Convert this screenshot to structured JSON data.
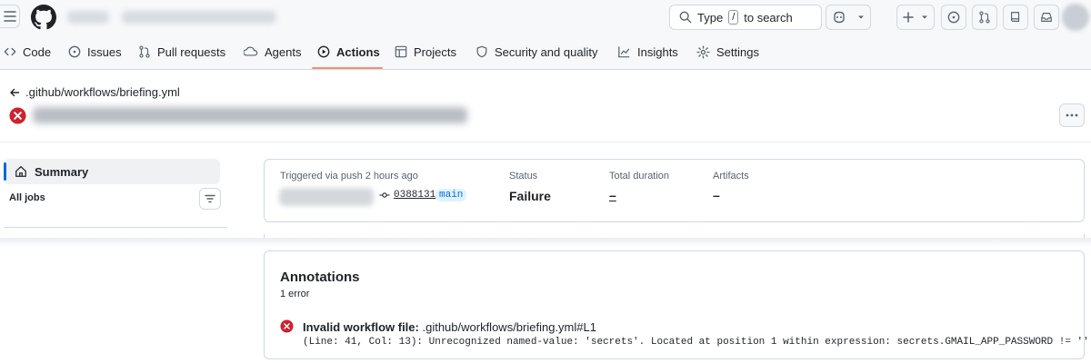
{
  "header": {
    "search_prefix": "Type",
    "search_key": "/",
    "search_suffix": "to search"
  },
  "nav": {
    "items": [
      {
        "label": "Code",
        "icon": "code-icon"
      },
      {
        "label": "Issues",
        "icon": "issue-icon"
      },
      {
        "label": "Pull requests",
        "icon": "pull-request-icon"
      },
      {
        "label": "Agents",
        "icon": "agents-icon"
      },
      {
        "label": "Actions",
        "icon": "play-icon",
        "active": true
      },
      {
        "label": "Projects",
        "icon": "table-icon"
      },
      {
        "label": "Security and quality",
        "icon": "shield-icon"
      },
      {
        "label": "Insights",
        "icon": "graph-icon"
      },
      {
        "label": "Settings",
        "icon": "gear-icon"
      }
    ],
    "underline_color": "#fd8c73"
  },
  "run": {
    "back_label": ".github/workflows/briefing.yml",
    "status_color": "#cf222e"
  },
  "sidebar": {
    "summary_label": "Summary",
    "all_jobs_label": "All jobs"
  },
  "summary": {
    "trigger_label": "Triggered via push 2 hours ago",
    "commit_sha": "0388131",
    "branch": "main",
    "status_label": "Status",
    "status_value": "Failure",
    "duration_label": "Total duration",
    "duration_value": "–",
    "artifacts_label": "Artifacts",
    "artifacts_value": "–"
  },
  "annotations": {
    "title": "Annotations",
    "count": "1 error",
    "items": [
      {
        "heading": "Invalid workflow file:",
        "file": ".github/workflows/briefing.yml#L1",
        "message": "(Line: 41, Col: 13): Unrecognized named-value: 'secrets'. Located at position 1 within expression: secrets.GMAIL_APP_PASSWORD != ''"
      }
    ]
  }
}
